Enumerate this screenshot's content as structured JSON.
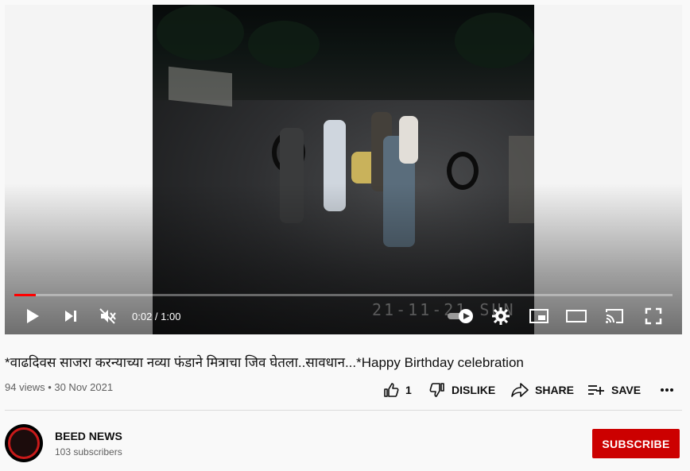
{
  "player": {
    "burned_in_timestamp": "21-11-21 SUN",
    "time_current": "0:02",
    "time_separator": " / ",
    "time_total": "1:00",
    "progress_fraction": 0.033,
    "controls": [
      "play-icon",
      "next-icon",
      "muted-volume-icon",
      "autoplay-toggle",
      "settings-icon",
      "miniplayer-icon",
      "theater-icon",
      "cast-icon",
      "fullscreen-icon"
    ]
  },
  "video": {
    "title": "*वाढदिवस साजरा करन्याच्या नव्या फंडाने मित्राचा जिव घेतला..सावधान...*Happy Birthday celebration",
    "views": "94 views",
    "bullet": " • ",
    "date": "30 Nov 2021"
  },
  "actions": {
    "like_count": "1",
    "dislike_label": "DISLIKE",
    "share_label": "SHARE",
    "save_label": "SAVE"
  },
  "channel": {
    "name": "BEED NEWS",
    "subscribers": "103 subscribers",
    "subscribe_label": "SUBSCRIBE"
  },
  "colors": {
    "accent_red": "#ff0000",
    "subscribe_bg": "#cc0000",
    "muted_text": "#606060"
  }
}
